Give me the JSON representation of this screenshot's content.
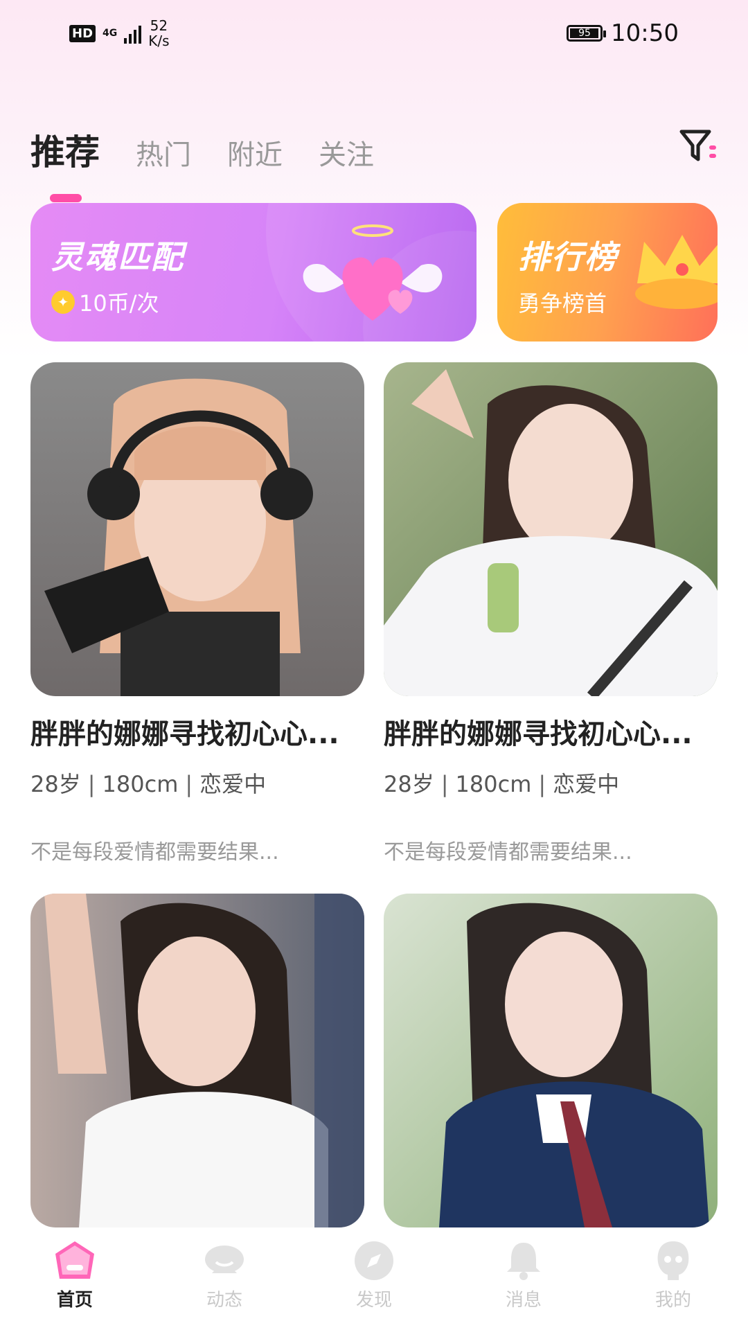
{
  "status_bar": {
    "hd": "HD",
    "network": "4G",
    "speed_value": "52",
    "speed_unit": "K/s",
    "battery": "95",
    "time": "10:50"
  },
  "tabs": [
    {
      "label": "推荐",
      "active": true
    },
    {
      "label": "热门",
      "active": false
    },
    {
      "label": "附近",
      "active": false
    },
    {
      "label": "关注",
      "active": false
    }
  ],
  "banners": {
    "soul_match": {
      "title": "灵魂匹配",
      "subtitle": "10币/次"
    },
    "ranking": {
      "title": "排行榜",
      "subtitle": "勇争榜首"
    }
  },
  "cards": [
    {
      "name": "胖胖的娜娜寻找初心心...",
      "age": "28岁",
      "height": "180cm",
      "status": "恋爱中",
      "bio": "不是每段爱情都需要结果..."
    },
    {
      "name": "胖胖的娜娜寻找初心心...",
      "age": "28岁",
      "height": "180cm",
      "status": "恋爱中",
      "bio": "不是每段爱情都需要结果..."
    },
    {
      "name": "",
      "age": "",
      "height": "",
      "status": "",
      "bio": ""
    },
    {
      "name": "",
      "age": "",
      "height": "",
      "status": "",
      "bio": ""
    }
  ],
  "nav": [
    {
      "label": "首页",
      "icon": "home-icon",
      "active": true
    },
    {
      "label": "动态",
      "icon": "moments-icon",
      "active": false
    },
    {
      "label": "发现",
      "icon": "discover-compass-icon",
      "active": false
    },
    {
      "label": "消息",
      "icon": "message-bell-icon",
      "active": false
    },
    {
      "label": "我的",
      "icon": "profile-icon",
      "active": false
    }
  ],
  "colors": {
    "accent": "#ff4da6",
    "soul_match_banner": "#d684f8",
    "ranking_banner": "#ffa14f"
  }
}
